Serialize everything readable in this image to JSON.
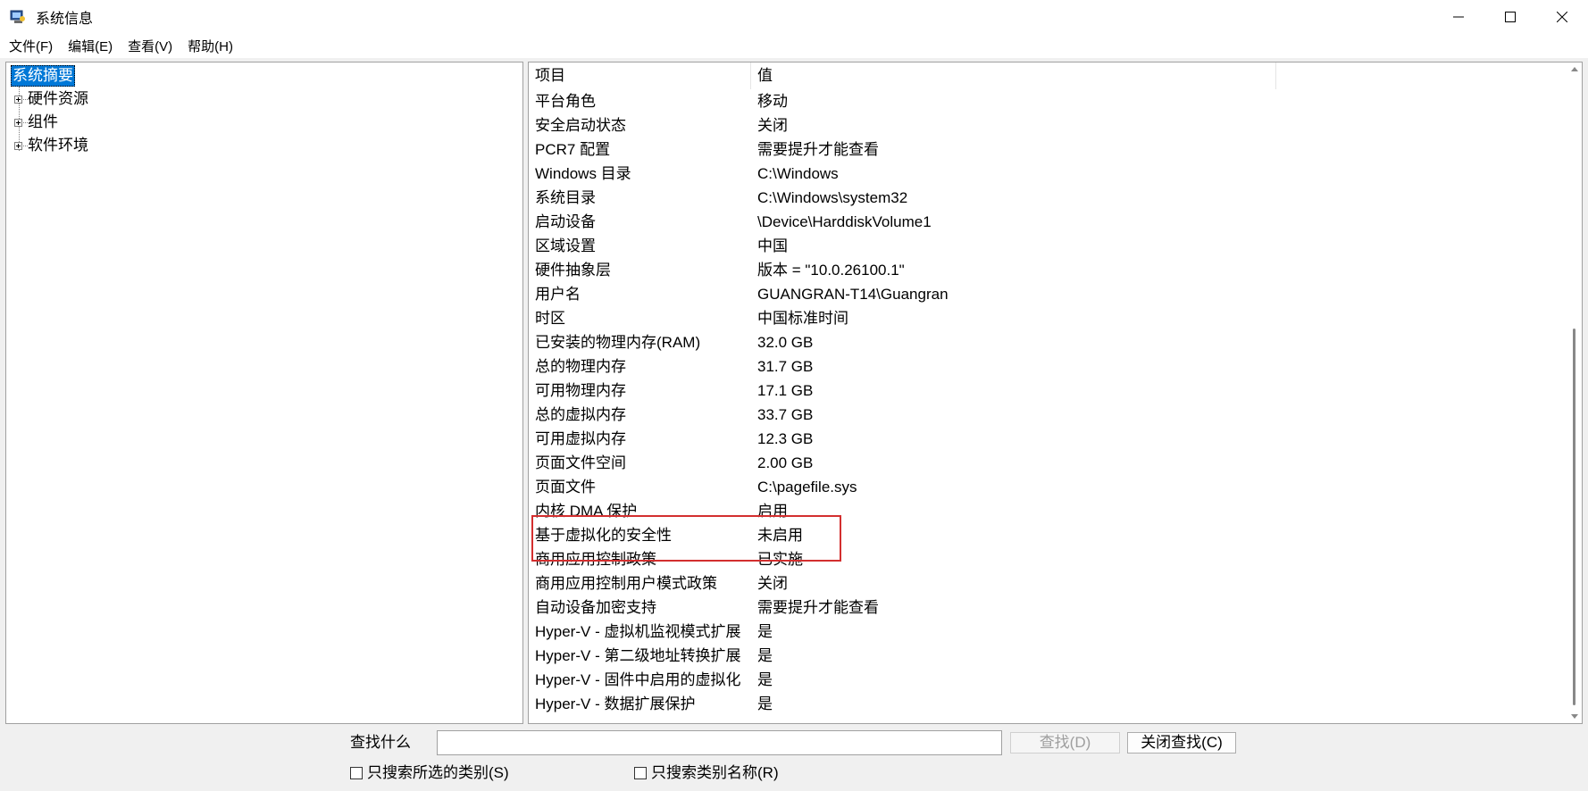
{
  "window": {
    "title": "系统信息"
  },
  "menu": [
    "文件(F)",
    "编辑(E)",
    "查看(V)",
    "帮助(H)"
  ],
  "tree": {
    "selected": "系统摘要",
    "children": [
      "硬件资源",
      "组件",
      "软件环境"
    ]
  },
  "table": {
    "headers": [
      "项目",
      "值"
    ],
    "rows": [
      [
        "平台角色",
        "移动"
      ],
      [
        "安全启动状态",
        "关闭"
      ],
      [
        "PCR7 配置",
        "需要提升才能查看"
      ],
      [
        "Windows 目录",
        "C:\\Windows"
      ],
      [
        "系统目录",
        "C:\\Windows\\system32"
      ],
      [
        "启动设备",
        "\\Device\\HarddiskVolume1"
      ],
      [
        "区域设置",
        "中国"
      ],
      [
        "硬件抽象层",
        "版本 = \"10.0.26100.1\""
      ],
      [
        "用户名",
        "GUANGRAN-T14\\Guangran"
      ],
      [
        "时区",
        "中国标准时间"
      ],
      [
        "已安装的物理内存(RAM)",
        "32.0 GB"
      ],
      [
        "总的物理内存",
        "31.7 GB"
      ],
      [
        "可用物理内存",
        "17.1 GB"
      ],
      [
        "总的虚拟内存",
        "33.7 GB"
      ],
      [
        "可用虚拟内存",
        "12.3 GB"
      ],
      [
        "页面文件空间",
        "2.00 GB"
      ],
      [
        "页面文件",
        "C:\\pagefile.sys"
      ],
      [
        "内核 DMA 保护",
        "启用"
      ],
      [
        "基于虚拟化的安全性",
        "未启用"
      ],
      [
        "商用应用控制政策",
        "已实施"
      ],
      [
        "商用应用控制用户模式政策",
        "关闭"
      ],
      [
        "自动设备加密支持",
        "需要提升才能查看"
      ],
      [
        "Hyper-V - 虚拟机监视模式扩展",
        "是"
      ],
      [
        "Hyper-V - 第二级地址转换扩展",
        "是"
      ],
      [
        "Hyper-V - 固件中启用的虚拟化",
        "是"
      ],
      [
        "Hyper-V - 数据扩展保护",
        "是"
      ]
    ]
  },
  "find": {
    "label": "查找什么",
    "value": "",
    "find_button": "查找(D)",
    "close_button": "关闭查找(C)",
    "checkbox_selected_category": "只搜索所选的类别(S)",
    "checkbox_category_names": "只搜索类别名称(R)"
  },
  "colors": {
    "selection": "#0078d7",
    "highlight_border": "#d32f2f"
  }
}
